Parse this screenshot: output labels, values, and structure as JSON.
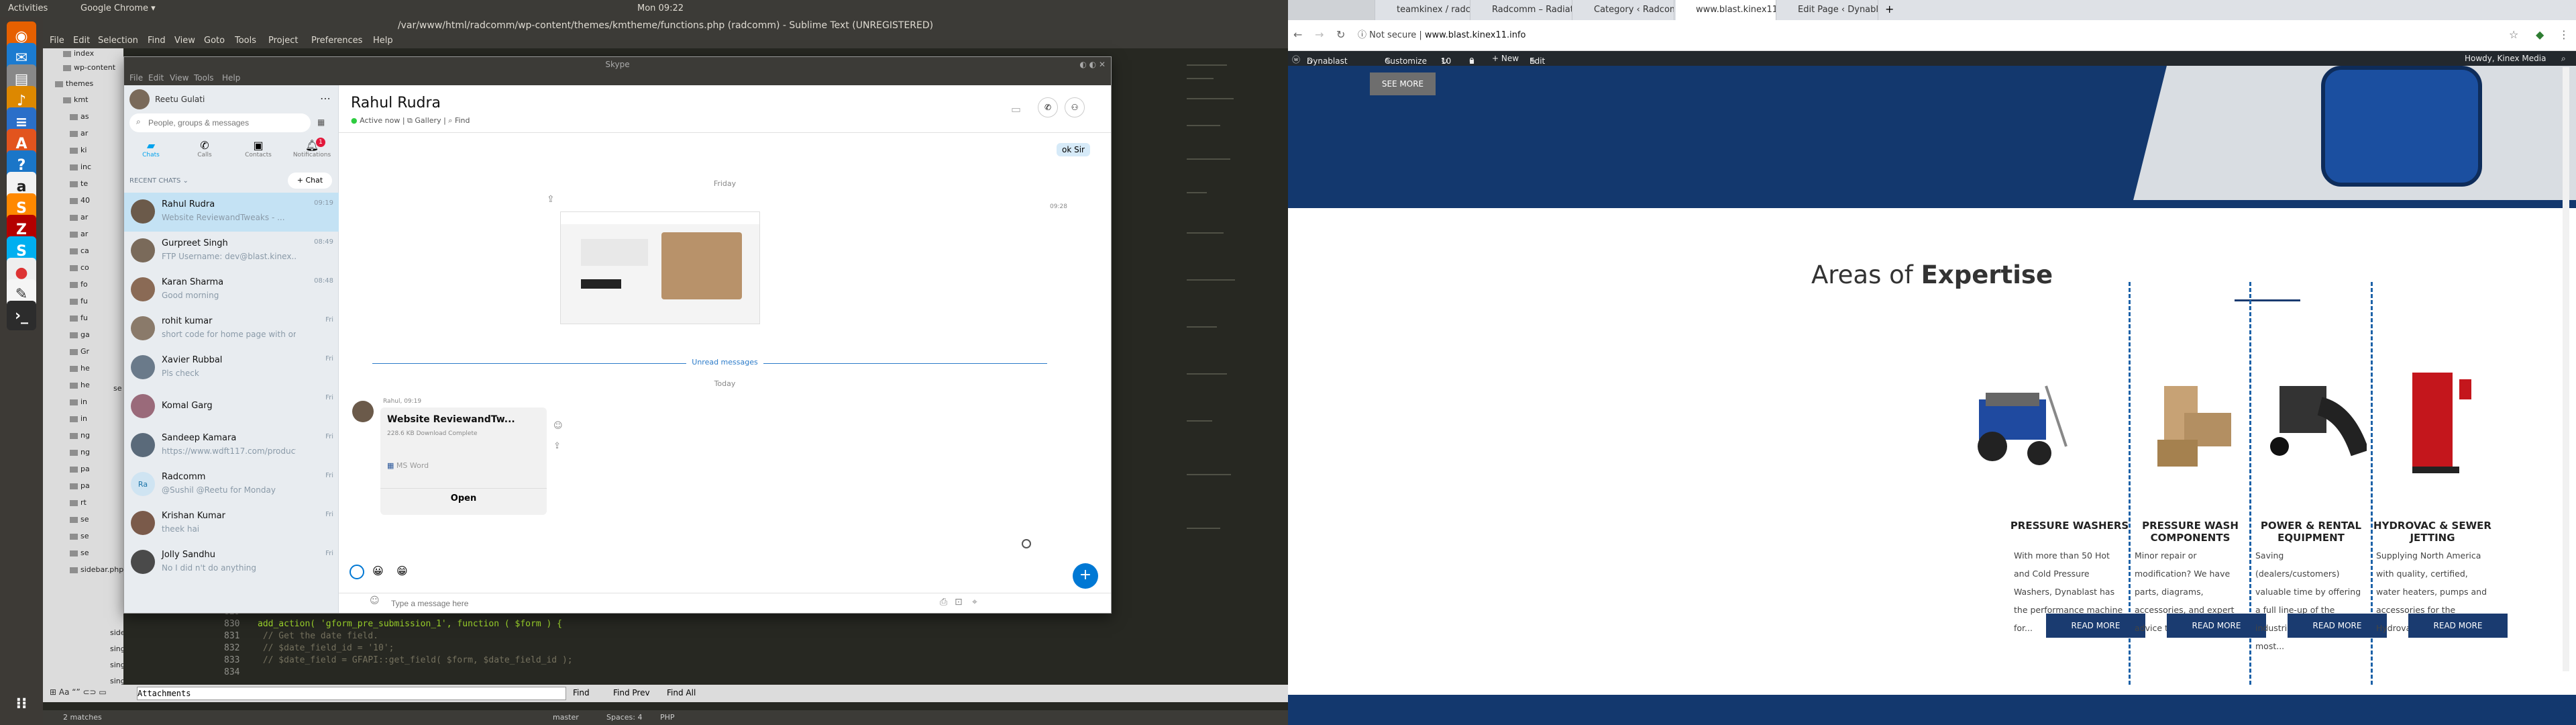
{
  "topbar": {
    "activities": "Activities",
    "app": "Google Chrome ▾",
    "clock": "Mon 09:22"
  },
  "sublime": {
    "title": "/var/www/html/radcomm/wp-content/themes/kmtheme/functions.php (radcomm) - Sublime Text (UNREGISTERED)",
    "menu": [
      "File",
      "Edit",
      "Selection",
      "Find",
      "View",
      "Goto",
      "Tools",
      "Project",
      "Preferences",
      "Help"
    ],
    "sidebar_files": [
      "index",
      "wp-content",
      "themes",
      "kmt",
      "as",
      "ar",
      "ki",
      "inc",
      "te",
      "40",
      "ar",
      "ar",
      "ca",
      "co",
      "fo",
      "fu",
      "fu",
      "ga",
      "Gr",
      "he",
      "he",
      "in",
      "in",
      "ng",
      "ng",
      "pa",
      "pa",
      "rt",
      "se",
      "se",
      "se",
      "sidebar.php",
      "single-event.php",
      "single-km-solutions.php",
      "single-leadership.php"
    ],
    "code": [
      {
        "num": "829",
        "text": ""
      },
      {
        "num": "830",
        "text": "add_action( 'gform_pre_submission_1', function ( $form ) {"
      },
      {
        "num": "831",
        "text": "    // Get the date field."
      },
      {
        "num": "832",
        "text": "    // $date_field_id = '10';"
      },
      {
        "num": "833",
        "text": "    // $date_field    = GFAPI::get_field( $form, $date_field_id );"
      },
      {
        "num": "834",
        "text": ""
      }
    ],
    "find": {
      "value": "Attachments",
      "find": "Find",
      "find_prev": "Find Prev",
      "find_all": "Find All"
    },
    "status": {
      "matches": "2 matches",
      "branch": "master",
      "spaces": "Spaces: 4",
      "syntax": "PHP"
    }
  },
  "skype": {
    "window_title": "Skype",
    "menu": [
      "File",
      "Edit",
      "View",
      "Tools",
      "Help"
    ],
    "me": "Reetu Gulati",
    "search_placeholder": "People, groups & messages",
    "nav": [
      "Chats",
      "Calls",
      "Contacts",
      "Notifications"
    ],
    "notif_count": "1",
    "recent": "RECENT CHATS ⌄",
    "new_chat": "+ Chat",
    "chats": [
      {
        "name": "Rahul Rudra",
        "msg": "Website ReviewandTweaks - ...",
        "time": "09:19",
        "color": "#6b5a4a"
      },
      {
        "name": "Gurpreet Singh",
        "msg": "FTP Username: dev@blast.kinex...",
        "time": "08:49",
        "color": "#7a6a5a"
      },
      {
        "name": "Karan Sharma",
        "msg": "Good morning",
        "time": "08:48",
        "color": "#8a6a55"
      },
      {
        "name": "rohit kumar",
        "msg": "short code for home page with or...",
        "time": "Fri",
        "color": "#8a7a6a"
      },
      {
        "name": "Xavier Rubbal",
        "msg": "Pls check",
        "time": "Fri",
        "color": "#6a7a8a"
      },
      {
        "name": "Komal Garg",
        "msg": "",
        "time": "Fri",
        "color": "#9a6a7a"
      },
      {
        "name": "Sandeep Kamara",
        "msg": "https://www.wdft117.com/product...",
        "time": "Fri",
        "color": "#5a6a7a"
      },
      {
        "name": "Radcomm",
        "msg": "@Sushil @Reetu for Monday",
        "time": "Fri",
        "color": "#cfe4f2"
      },
      {
        "name": "Krishan Kumar",
        "msg": "theek hai",
        "time": "Fri",
        "color": "#7a5a4a"
      },
      {
        "name": "Jolly Sandhu",
        "msg": "No I did n't do anything",
        "time": "Fri",
        "color": "#4a4a4a"
      }
    ],
    "contact": "Rahul Rudra",
    "status": "Active now",
    "gallery": "Gallery",
    "find": "Find",
    "last_msg": "ok Sir",
    "day1": "Friday",
    "img_time": "09:28",
    "unread": "Unread messages",
    "day2": "Today",
    "sender_meta": "Rahul, 09:19",
    "file_name": "Website ReviewandTw...",
    "file_meta": "228.6 KB Download Complete",
    "file_type": "MS Word",
    "open_btn": "Open",
    "input_placeholder": "Type a message here"
  },
  "browser": {
    "tabs": [
      "teamkinex / radcomm — B...",
      "Radcomm – Radiation De...",
      "Category ‹ Radcomm — ...",
      "www.blast.kinex11.info",
      "Edit Page ‹ Dynablast Equ..."
    ],
    "not_secure": "Not secure",
    "url": "www.blast.kinex11.info",
    "wpbar": [
      "Dynablast Equipment",
      "Customize",
      "10",
      "0",
      "+ New",
      "Edit Page"
    ],
    "howdy": "Howdy, Kinex Media",
    "see_more": "SEE MORE",
    "heading_light": "Areas of",
    "heading_bold": "Expertise",
    "cards": [
      {
        "title": "PRESSURE WASHERS",
        "text": "With more than 50 Hot and Cold Pressure Washers, Dynablast has the performance machine for...",
        "btn": "READ MORE"
      },
      {
        "title": "PRESSURE WASH COMPONENTS",
        "text": "Minor repair or modification? We have parts, diagrams, accessories, and expert advice to help your...",
        "btn": "READ MORE"
      },
      {
        "title": "POWER & RENTAL EQUIPMENT",
        "text": "Saving (dealers/customers) valuable time by offering a full line-up of the industries best and most...",
        "btn": "READ MORE"
      },
      {
        "title": "HYDROVAC & SEWER JETTING",
        "text": "Supplying North America with quality, certified, water heaters, pumps and accessories for the Hydrovac industry...",
        "btn": "READ MORE"
      }
    ]
  },
  "colors": {
    "wp_navy": "#13386e",
    "button": "#1a3b70",
    "skype_blue": "#00a2ed",
    "accent_line": "#1d62a8"
  }
}
